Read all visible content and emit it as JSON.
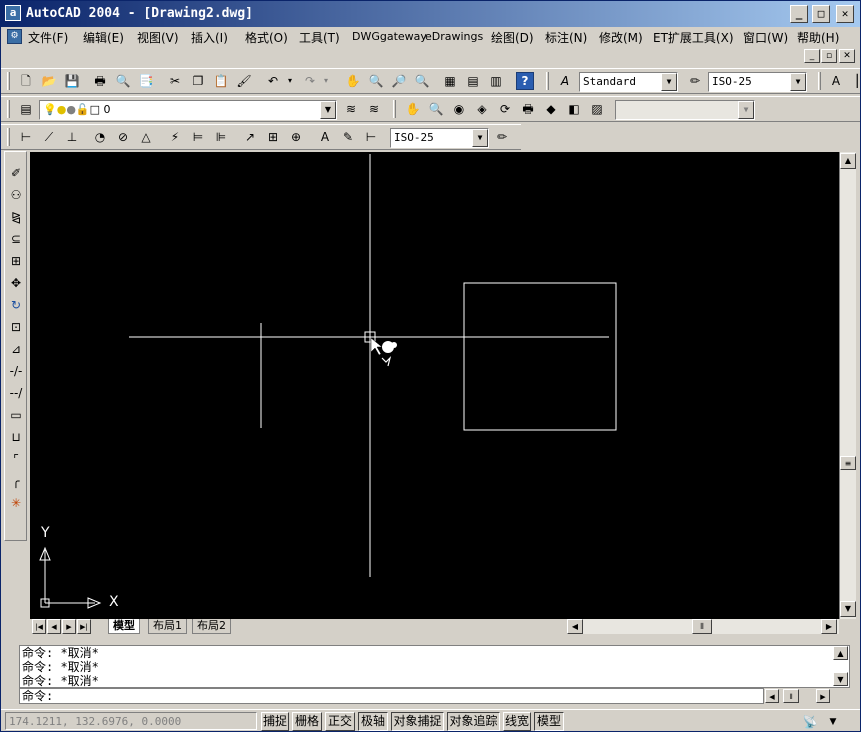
{
  "window": {
    "title": "AutoCAD 2004 - [Drawing2.dwg]",
    "app_icon": "autocad-logo-icon"
  },
  "menu": [
    "文件(F)",
    "编辑(E)",
    "视图(V)",
    "插入(I)",
    "格式(O)",
    "工具(T)",
    "DWGgateway",
    "eDrawings",
    "绘图(D)",
    "标注(N)",
    "修改(M)",
    "ET扩展工具(X)",
    "窗口(W)",
    "帮助(H)"
  ],
  "toolbar": {
    "text_style": "Standard",
    "dim_style": "ISO-25",
    "layer": "0",
    "dim_style_2": "ISO-25",
    "linetype": ""
  },
  "layout_tabs": [
    "模型",
    "布局1",
    "布局2"
  ],
  "command": {
    "lines": [
      "命令: *取消*",
      "命令: *取消*",
      "命令: *取消*"
    ],
    "prompt": "命令:"
  },
  "status": {
    "coords": "174.1211, 132.6976, 0.0000",
    "toggles": [
      {
        "label": "捕捉",
        "on": false
      },
      {
        "label": "栅格",
        "on": false
      },
      {
        "label": "正交",
        "on": false
      },
      {
        "label": "极轴",
        "on": true
      },
      {
        "label": "对象捕捉",
        "on": true
      },
      {
        "label": "对象追踪",
        "on": true
      },
      {
        "label": "线宽",
        "on": false
      },
      {
        "label": "模型",
        "on": true
      }
    ]
  },
  "ucs": {
    "x": "X",
    "y": "Y"
  },
  "colors": {
    "canvas": "#000000",
    "title_start": "#0a246a",
    "title_end": "#a6caf0",
    "chrome": "#d4d0c8"
  }
}
